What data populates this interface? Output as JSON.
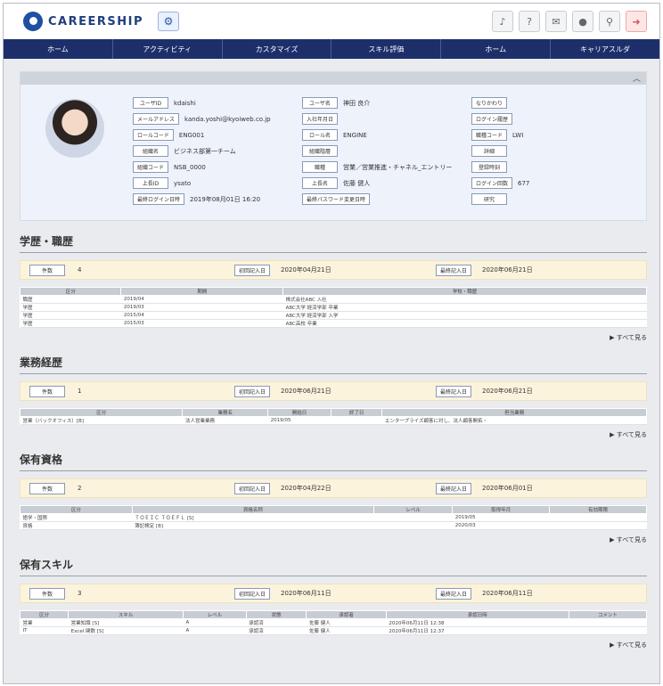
{
  "app": {
    "brand": "CAREERSHIP",
    "settings_icon": "settings-icon"
  },
  "top_icons": [
    "bell-icon",
    "help-icon",
    "mail-icon",
    "user-icon",
    "search-icon",
    "logout-icon"
  ],
  "nav": [
    "ホーム",
    "アクティビティ",
    "カスタマイズ",
    "スキル評価",
    "ホーム",
    "キャリアスルダ"
  ],
  "profile": {
    "col1": [
      {
        "tag": "ユーザID",
        "value": "kdaishi"
      },
      {
        "tag": "メールアドレス",
        "value": "kanda.yoshi@kyoiweb.co.jp"
      },
      {
        "tag": "ロールコード",
        "value": "ENG001"
      },
      {
        "tag": "組織名",
        "value": "ビジネス部第一チーム"
      },
      {
        "tag": "組織コード",
        "value": "NSB_0000"
      },
      {
        "tag": "上長ID",
        "value": "ysato"
      },
      {
        "tag": "最終ログイン日時",
        "value": "2019年08月01日 16:20"
      }
    ],
    "col2": [
      {
        "tag": "ユーザ名",
        "value": "神田 良介"
      },
      {
        "tag": "入社年月日",
        "value": ""
      },
      {
        "tag": "ロール名",
        "value": "ENGINE"
      },
      {
        "tag": "組織階層",
        "value": ""
      },
      {
        "tag": "職種",
        "value": "営業／営業推進・チャネル_エントリー"
      },
      {
        "tag": "上長名",
        "value": "佐藤 健人"
      },
      {
        "tag": "最終パスワード変更日時",
        "value": ""
      }
    ],
    "col3": [
      {
        "tag": "なりかわり",
        "value": ""
      },
      {
        "tag": "ログイン履歴",
        "value": ""
      },
      {
        "tag": "職種コード",
        "value": "LWI"
      },
      {
        "tag": "詳細",
        "value": ""
      },
      {
        "tag": "登録時刻",
        "value": ""
      },
      {
        "tag": "ログイン回数",
        "value": "677"
      },
      {
        "tag": "研究",
        "value": ""
      }
    ]
  },
  "sections": [
    {
      "title": "学歴・職歴",
      "count_tag": "件数",
      "count": "4",
      "created_tag": "初回記入日",
      "created": "2020年04月21日",
      "updated_tag": "最終記入日",
      "updated": "2020年06月21日",
      "headers": [
        "区分",
        "期間",
        "学校・職歴"
      ],
      "rows": [
        [
          "職歴",
          "2019/04",
          "株式会社ABC 入社"
        ],
        [
          "学歴",
          "2019/03",
          "ABC大学 経済学部 卒業"
        ],
        [
          "学歴",
          "2015/04",
          "ABC大学 経済学部 入学"
        ],
        [
          "学歴",
          "2015/03",
          "ABC高校 卒業"
        ]
      ],
      "more": "すべて見る"
    },
    {
      "title": "業務経歴",
      "count_tag": "件数",
      "count": "1",
      "created_tag": "初回記入日",
      "created": "2020年06月21日",
      "updated_tag": "最終記入日",
      "updated": "2020年06月21日",
      "headers": [
        "区分",
        "業務名",
        "開始日",
        "終了日",
        "担当業務"
      ],
      "rows": [
        [
          "営業（バックオフィス）[B]",
          "法人営業業務",
          "2019/05",
          "",
          "エンタープライズ顧客に対し、法人顧客開拓・"
        ]
      ],
      "more": "すべて見る"
    },
    {
      "title": "保有資格",
      "count_tag": "件数",
      "count": "2",
      "created_tag": "初回記入日",
      "created": "2020年04月22日",
      "updated_tag": "最終記入日",
      "updated": "2020年06月01日",
      "headers": [
        "区分",
        "資格名称",
        "レベル",
        "取得年月",
        "有効期限"
      ],
      "rows": [
        [
          "語学・国際",
          "ＴＯＥＩＣ ＴＯＥＦＬ [S]",
          "",
          "2019/05",
          ""
        ],
        [
          "資格",
          "簿記検定 [B]",
          "",
          "2020/03",
          ""
        ]
      ],
      "more": "すべて見る"
    },
    {
      "title": "保有スキル",
      "count_tag": "件数",
      "count": "3",
      "created_tag": "初回記入日",
      "created": "2020年06月11日",
      "updated_tag": "最終記入日",
      "updated": "2020年06月11日",
      "headers": [
        "区分",
        "スキル",
        "レベル",
        "状態",
        "承認者",
        "承認日時",
        "コメント"
      ],
      "rows": [
        [
          "営業",
          "営業知識 [S]",
          "A",
          "承認済",
          "佐藤 健人",
          "2020年06月11日 12:38",
          ""
        ],
        [
          "IT",
          "Excel 関数 [S]",
          "A",
          "承認済",
          "佐藤 健人",
          "2020年06月11日 12:37",
          ""
        ]
      ],
      "more": "すべて見る"
    }
  ]
}
